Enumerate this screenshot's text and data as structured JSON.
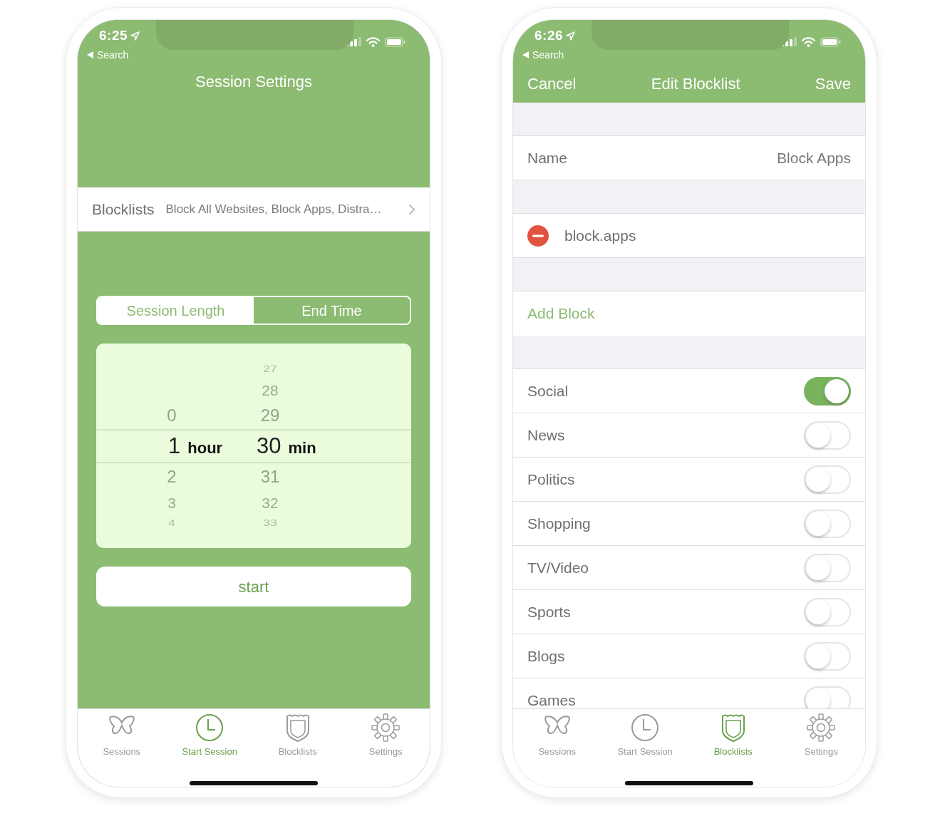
{
  "screens": [
    {
      "kind": "session_settings",
      "status_bar": {
        "time": "6:25",
        "back": "Search"
      },
      "title": "Session Settings",
      "blocklists_row": {
        "label": "Blocklists",
        "value": "Block All Websites, Block Apps, Distra…"
      },
      "segments": [
        {
          "label": "Session Length",
          "selected": false
        },
        {
          "label": "End Time",
          "selected": true
        }
      ],
      "picker": {
        "columns": [
          {
            "unit": "hour",
            "items": [
              {
                "value": "0",
                "selected": false
              },
              {
                "value": "1",
                "selected": true
              },
              {
                "value": "2",
                "selected": false
              },
              {
                "value": "3",
                "selected": false
              },
              {
                "value": "4",
                "selected": false
              }
            ]
          },
          {
            "unit": "min",
            "items": [
              {
                "value": "27",
                "selected": false
              },
              {
                "value": "28",
                "selected": false
              },
              {
                "value": "29",
                "selected": false
              },
              {
                "value": "30",
                "selected": true
              },
              {
                "value": "31",
                "selected": false
              },
              {
                "value": "32",
                "selected": false
              },
              {
                "value": "33",
                "selected": false
              }
            ]
          }
        ]
      },
      "start_button": "start",
      "tab_bar": [
        {
          "label": "Sessions",
          "selected": false
        },
        {
          "label": "Start Session",
          "selected": true
        },
        {
          "label": "Blocklists",
          "selected": false
        },
        {
          "label": "Settings",
          "selected": false
        }
      ]
    },
    {
      "kind": "edit_blocklist",
      "status_bar": {
        "time": "6:26",
        "back": "Search"
      },
      "nav": {
        "left": "Cancel",
        "title": "Edit Blocklist",
        "right": "Save"
      },
      "name_row": {
        "label": "Name",
        "value": "Block Apps"
      },
      "blocks": [
        {
          "label": "block.apps"
        }
      ],
      "add_block": "Add Block",
      "categories": [
        {
          "label": "Social",
          "on": true
        },
        {
          "label": "News",
          "on": false
        },
        {
          "label": "Politics",
          "on": false
        },
        {
          "label": "Shopping",
          "on": false
        },
        {
          "label": "TV/Video",
          "on": false
        },
        {
          "label": "Sports",
          "on": false
        },
        {
          "label": "Blogs",
          "on": false
        },
        {
          "label": "Games",
          "on": false
        }
      ],
      "tab_bar": [
        {
          "label": "Sessions",
          "selected": false
        },
        {
          "label": "Start Session",
          "selected": false
        },
        {
          "label": "Blocklists",
          "selected": true
        },
        {
          "label": "Settings",
          "selected": false
        }
      ]
    }
  ]
}
